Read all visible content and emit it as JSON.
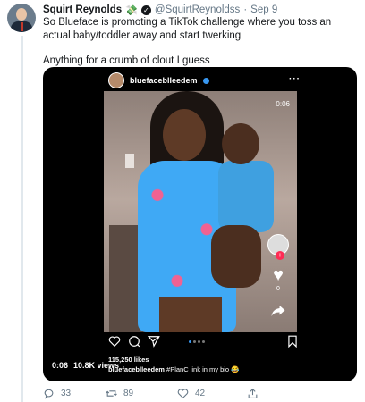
{
  "tweet": {
    "author_name": "Squirt Reynolds",
    "author_emoji": "💸",
    "author_handle": "@SquirtReynoldss",
    "separator": "·",
    "timestamp": "Sep 9",
    "text_line1": "So Blueface is promoting a TikTok challenge where you toss an actual baby/toddler away and start twerking",
    "text_line2": "Anything for a crumb of clout I guess"
  },
  "media": {
    "ig_username": "bluefaceblleedem",
    "ig_more": "···",
    "duration_overlay": "0:06",
    "tiktok_comment_count": "0",
    "likes": "115,250 likes",
    "caption_user": "bluefaceblleedem",
    "caption_text": "#PlanC link in my bio 😂",
    "player_time": "0:06",
    "player_views": "10.8K views"
  },
  "actions": {
    "replies": "33",
    "retweets": "89",
    "likes": "42"
  },
  "colors": {
    "accent_blue": "#1da1f2",
    "muted_gray": "#657786",
    "tiktok_red": "#fe2c55"
  }
}
